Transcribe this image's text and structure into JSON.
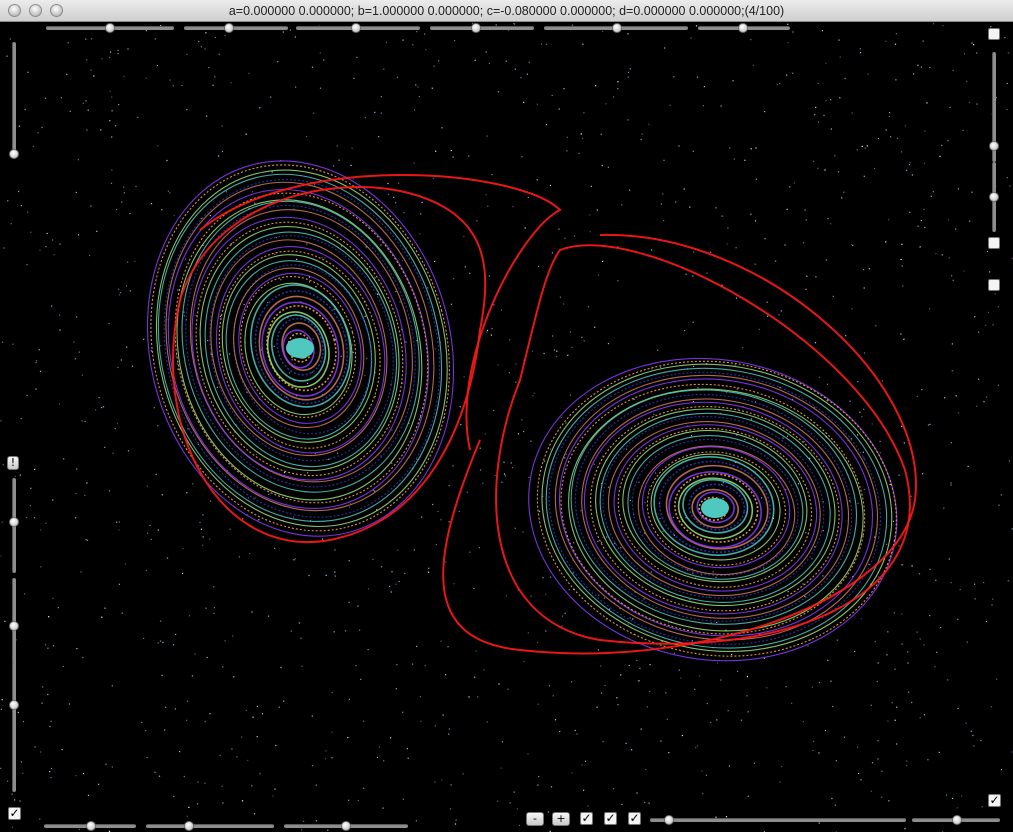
{
  "window": {
    "title": "a=0.000000 0.000000; b=1.000000 0.000000; c=-0.080000 0.000000; d=0.000000 0.000000;(4/100)"
  },
  "controls": {
    "minus_label": "-",
    "plus_label": "+",
    "alert_label": "!",
    "check_mark": "✓",
    "top_slider_values": [
      0.5,
      0.45,
      0.5,
      0.5,
      0.5,
      0.5
    ],
    "bottom_slider_values": [
      0.5,
      0.3,
      0.5,
      0.1
    ],
    "left_slider_values": [
      1.0,
      0.5,
      0.5,
      0.5
    ],
    "right_slider_values": [
      0.85,
      0.5
    ],
    "checkboxes_checked": {
      "bottom_left": true,
      "bottom_1": true,
      "bottom_2": true,
      "bottom_3": true,
      "bottom_right": true,
      "right_1": false,
      "right_2": false,
      "right_3": false
    }
  },
  "colors": {
    "background": "#000000",
    "attractor_red": "#ff1a1a",
    "attractor_blue": "#2a3cc0",
    "attractor_teal": "#4fc9c0",
    "attractor_green": "#9ee07a",
    "attractor_orange": "#ffb040",
    "attractor_purple": "#8a3cff",
    "attractor_salmon": "#d07a60"
  }
}
